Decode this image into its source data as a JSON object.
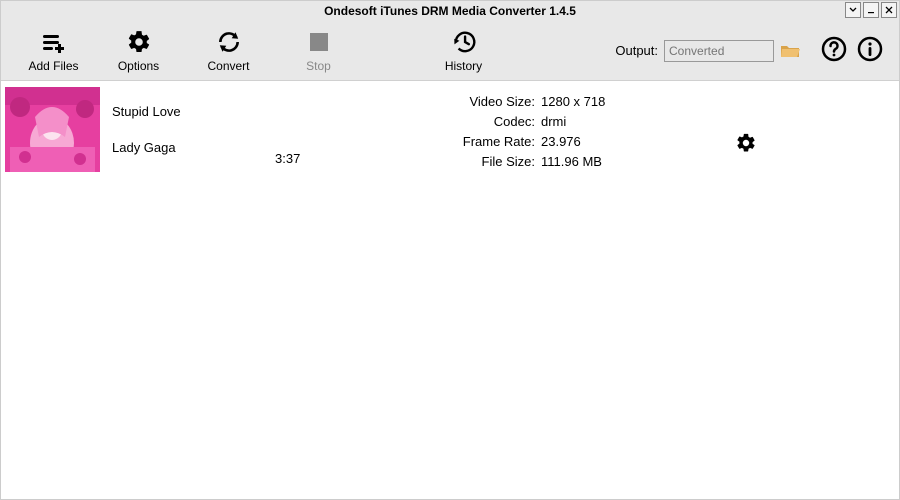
{
  "window": {
    "title": "Ondesoft iTunes DRM Media Converter 1.4.5"
  },
  "toolbar": {
    "add_files": "Add Files",
    "options": "Options",
    "convert": "Convert",
    "stop": "Stop",
    "history": "History"
  },
  "output": {
    "label": "Output:",
    "placeholder": "Converted"
  },
  "item": {
    "title": "Stupid Love",
    "artist": "Lady Gaga",
    "duration": "3:37",
    "meta": {
      "video_size_label": "Video Size:",
      "video_size": "1280 x 718",
      "codec_label": "Codec:",
      "codec": "drmi",
      "frame_rate_label": "Frame Rate:",
      "frame_rate": "23.976",
      "file_size_label": "File Size:",
      "file_size": "111.96 MB"
    }
  }
}
